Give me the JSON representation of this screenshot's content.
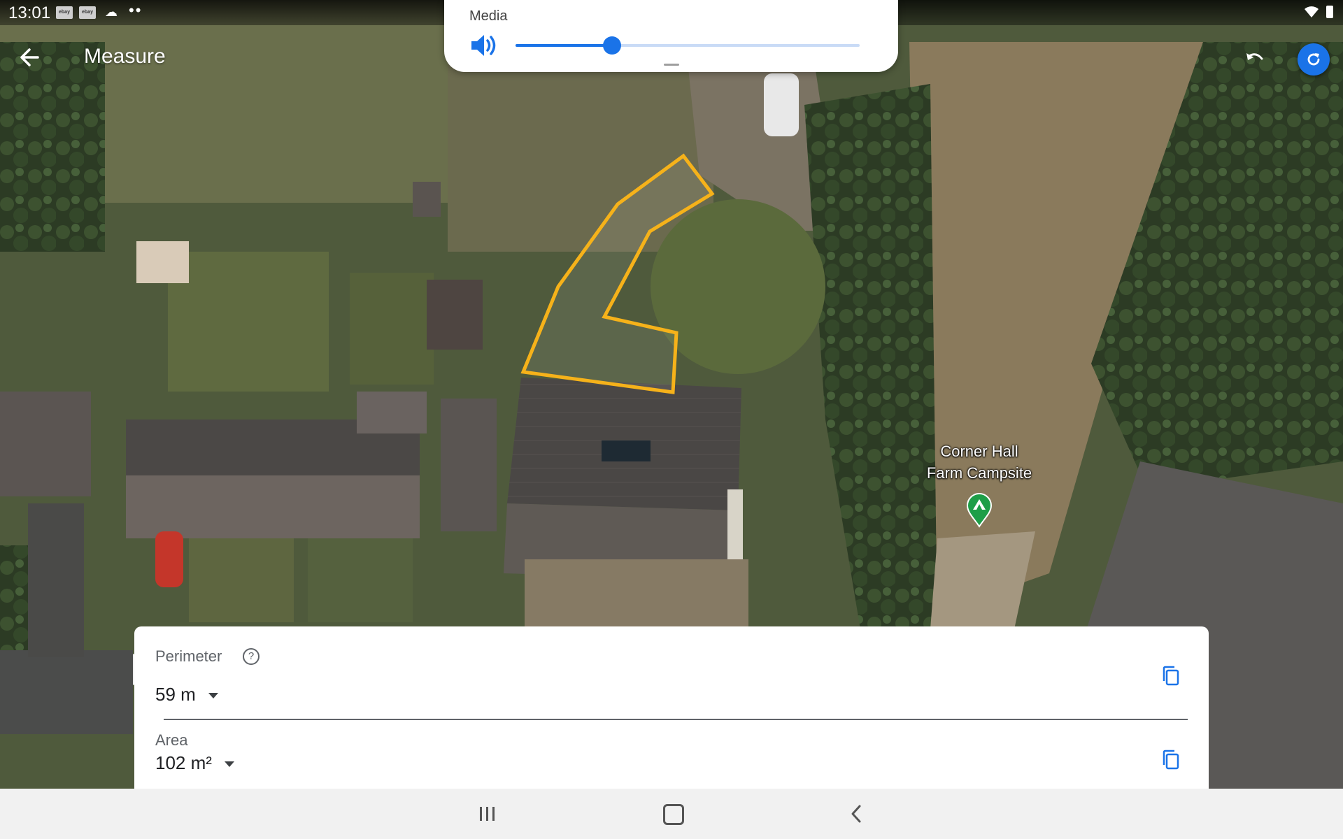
{
  "status_bar": {
    "time": "13:01",
    "notifications": [
      "ebay-icon",
      "ebay-icon",
      "cloud-icon",
      "more-icon"
    ],
    "more": "••",
    "ebay_label": "ebay"
  },
  "app_bar": {
    "title": "Measure",
    "refresh_color": "#1a73e8"
  },
  "volume_panel": {
    "title": "Media",
    "level": 0.28
  },
  "map": {
    "place_label": "Corner Hall\nFarm Campsite",
    "outline_color": "#f6b21a"
  },
  "measurement": {
    "perimeter_label": "Perimeter",
    "perimeter_help": "?",
    "perimeter_value": "59 m",
    "area_label": "Area",
    "area_value": "102 m²"
  },
  "navigation": {
    "items": [
      "recents",
      "home",
      "back"
    ]
  }
}
